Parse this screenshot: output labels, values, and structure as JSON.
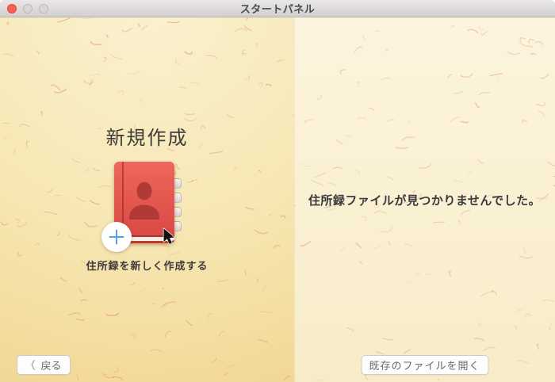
{
  "window": {
    "title": "スタートパネル"
  },
  "left_panel": {
    "heading": "新規作成",
    "caption": "住所録を新しく作成する"
  },
  "right_panel": {
    "message": "住所録ファイルが見つかりませんでした。"
  },
  "footer": {
    "back_label": "戻る",
    "open_label": "既存のファイルを開く"
  },
  "icons": {
    "chevron_left": "〈",
    "plus": "+"
  },
  "colors": {
    "book_red_light": "#ee665d",
    "book_red_dark": "#d84741",
    "silhouette_red": "#b23a36",
    "plus_blue": "#57a1e2",
    "left_bg_top": "#faf1d0",
    "left_bg_bottom": "#f2d794",
    "right_bg_top": "#fcf4de",
    "right_bg_bottom": "#f8ecc8",
    "close_red": "#f95e57"
  }
}
